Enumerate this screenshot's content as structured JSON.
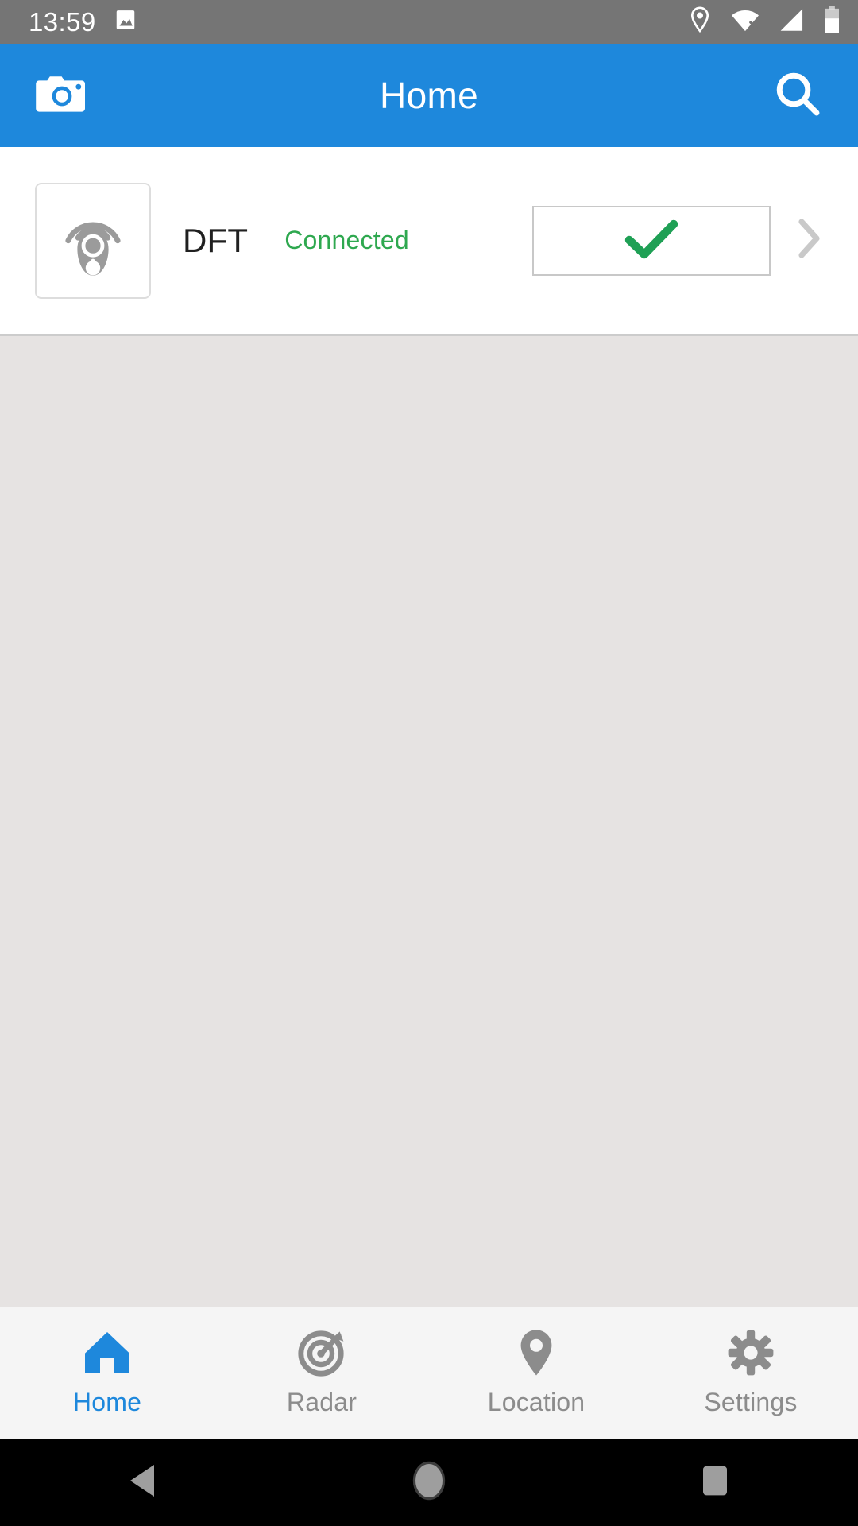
{
  "status_bar": {
    "time": "13:59",
    "left_icons": [
      "image-icon"
    ],
    "right_icons": [
      "location-pin-icon",
      "wifi-off-icon",
      "cellular-signal-icon",
      "battery-icon"
    ],
    "battery_level_percent": 60,
    "background_color": "#757575"
  },
  "app_bar": {
    "title": "Home",
    "left_action": "camera-icon",
    "right_action": "search-icon",
    "background_color": "#1E88DC",
    "text_color": "#FFFFFF"
  },
  "device_list": {
    "devices": [
      {
        "icon": "key-fob-signal-icon",
        "name": "DFT",
        "status": "Connected",
        "status_color": "#2EA84F",
        "action_icon": "check-icon",
        "action_icon_color": "#1FA055",
        "chevron": "chevron-right-icon"
      }
    ]
  },
  "content": {
    "background_color": "#E6E3E2",
    "items": []
  },
  "bottom_nav": {
    "active_color": "#1E88DC",
    "inactive_color": "#8C8C8C",
    "tabs": [
      {
        "label": "Home",
        "icon": "home-icon",
        "active": true
      },
      {
        "label": "Radar",
        "icon": "radar-icon",
        "active": false
      },
      {
        "label": "Location",
        "icon": "location-pin-icon",
        "active": false
      },
      {
        "label": "Settings",
        "icon": "gear-icon",
        "active": false
      }
    ]
  },
  "android_nav": {
    "buttons": [
      {
        "name": "back-button",
        "icon": "triangle-back-icon"
      },
      {
        "name": "home-button",
        "icon": "circle-home-icon"
      },
      {
        "name": "recents-button",
        "icon": "square-recents-icon"
      }
    ],
    "background_color": "#000000"
  }
}
